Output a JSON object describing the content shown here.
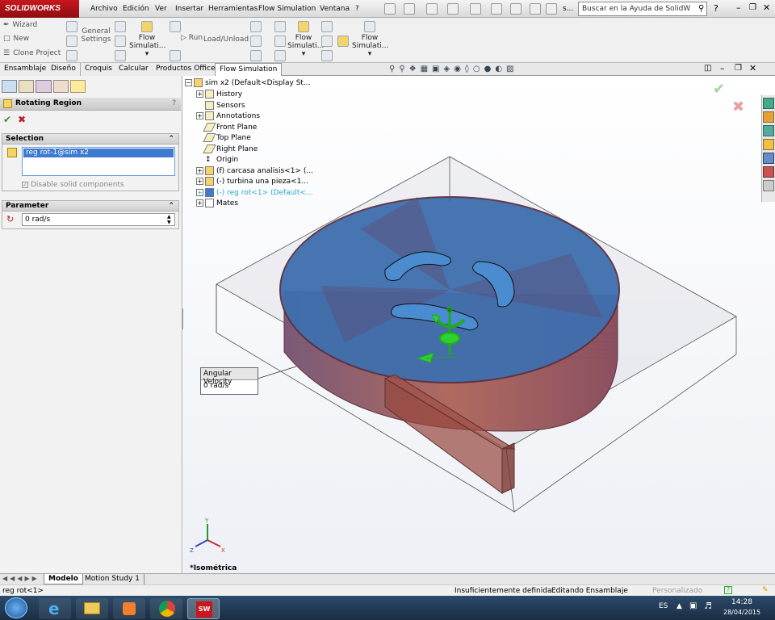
{
  "app": {
    "logo": "SOLIDWORKS"
  },
  "menubar": [
    "Archivo",
    "Edición",
    "Ver",
    "Insertar",
    "Herramientas",
    "Flow Simulation",
    "Ventana",
    "?"
  ],
  "quick_access": {
    "trailing": "s..."
  },
  "search": {
    "placeholder": "Buscar en la Ayuda de SolidW"
  },
  "command_manager": {
    "wizard": "Wizard",
    "new": "New",
    "clone": "Clone Project",
    "general_settings": "General Settings",
    "flow_sim1": "Flow Simulati...",
    "run": "Run",
    "load_unload": "Load/Unload",
    "flow_sim2": "Flow Simulati...",
    "flow_sim3": "Flow Simulati..."
  },
  "tabs": [
    "Ensamblaje",
    "Diseño",
    "Croquis",
    "Calcular",
    "Productos Office",
    "Flow Simulation"
  ],
  "active_tab": "Flow Simulation",
  "property_manager": {
    "title": "Rotating Region",
    "selection_header": "Selection",
    "selected_item": "reg rot-1@sim x2",
    "disable_solid": "Disable solid components",
    "parameter_header": "Parameter",
    "angular_value": "0 rad/s"
  },
  "tree": {
    "root": "sim x2  (Default<Display St...",
    "items": [
      "History",
      "Sensors",
      "Annotations",
      "Front Plane",
      "Top Plane",
      "Right Plane",
      "Origin",
      "(f) carcasa analisis<1> (...",
      "(-) turbina una pieza<1...",
      "(-) reg rot<1> (Default<...",
      "Mates"
    ]
  },
  "callout": {
    "title": "Angular Velocity",
    "value": "0 rad/s"
  },
  "view_label": "*Isométrica",
  "bottom_tabs": [
    "Modelo",
    "Motion Study 1"
  ],
  "status": {
    "left": "reg rot<1>",
    "defined": "Insuficientemente definida",
    "editing": "Editando Ensamblaje",
    "custom": "Personalizado"
  },
  "taskbar": {
    "lang": "ES",
    "time": "14:28",
    "date": "28/04/2015"
  },
  "colors": {
    "accent": "#c8171e",
    "disc": "#3f6fae",
    "frame": "#a0504a",
    "selection": "#3d7bd0"
  }
}
